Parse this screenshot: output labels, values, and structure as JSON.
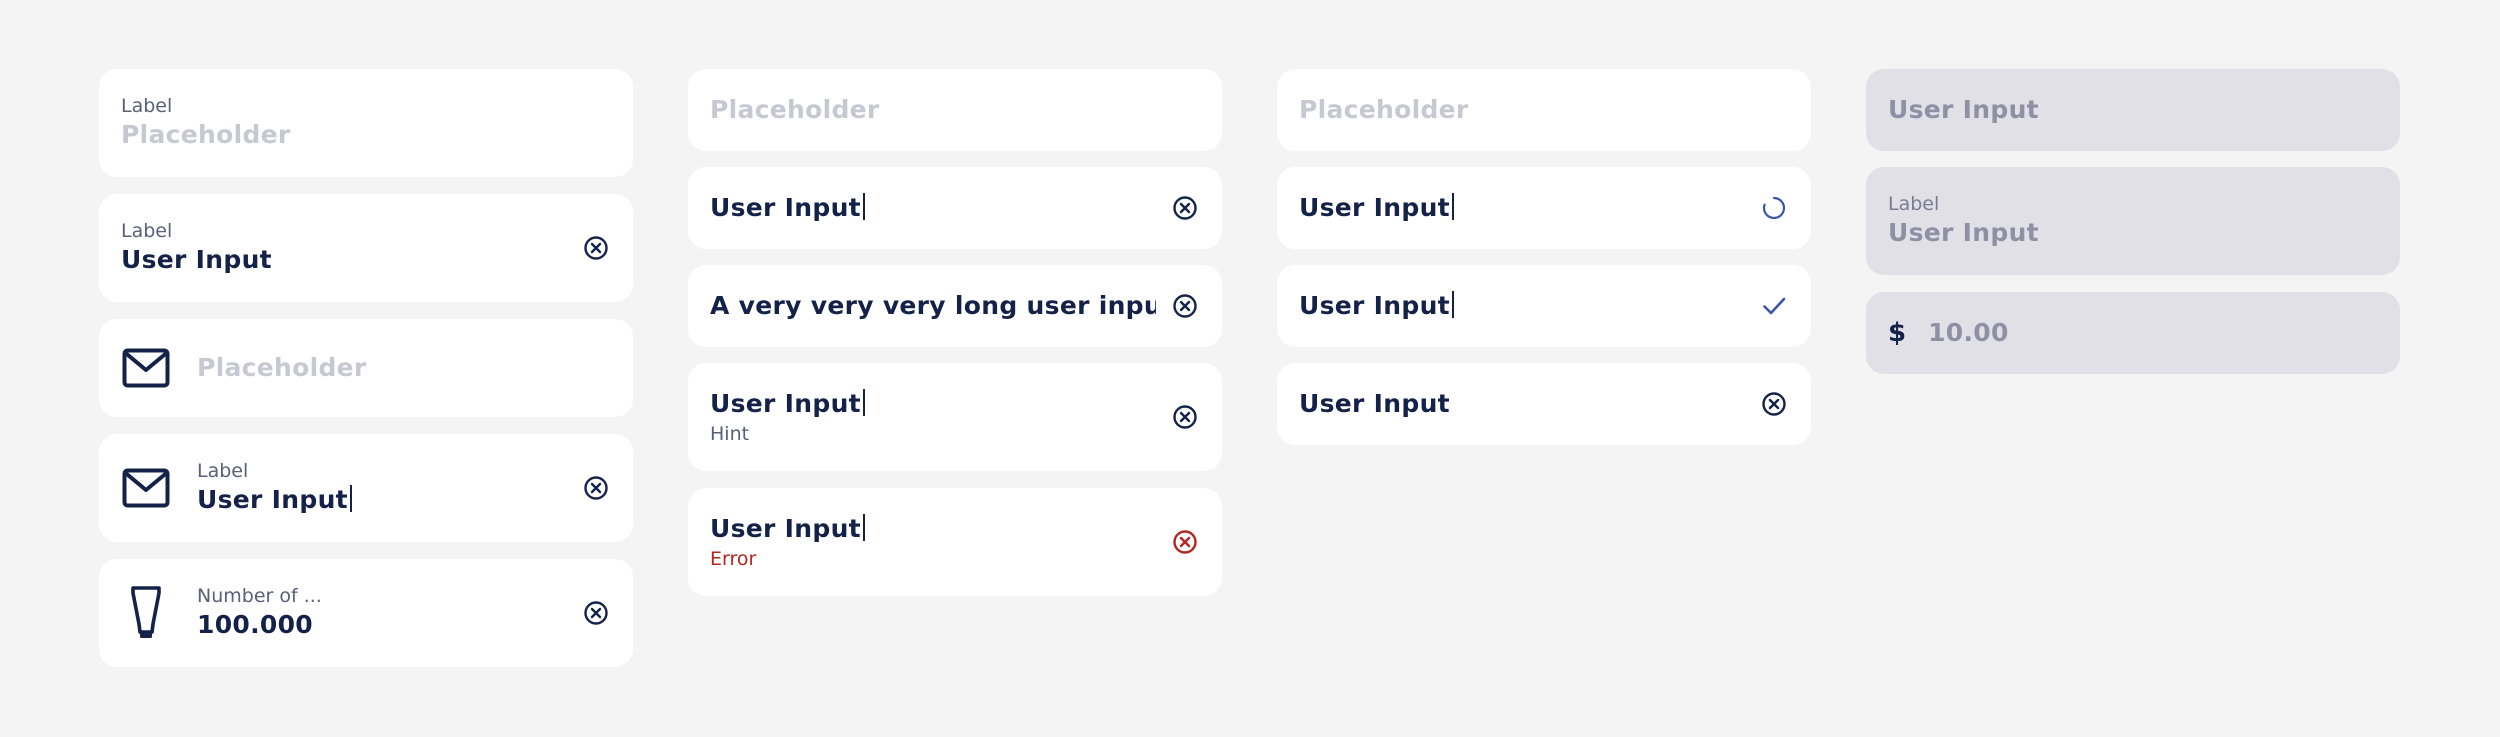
{
  "col1": {
    "f1": {
      "label": "Label",
      "placeholder": "Placeholder"
    },
    "f2": {
      "label": "Label",
      "value": "User Input"
    },
    "f3": {
      "placeholder": "Placeholder"
    },
    "f4": {
      "label": "Label",
      "value": "User Input"
    },
    "f5": {
      "label": "Number of ...",
      "value": "100.000"
    }
  },
  "col2": {
    "f1": {
      "placeholder": "Placeholder"
    },
    "f2": {
      "value": "User Input"
    },
    "f3": {
      "value": "A very very very long user input..."
    },
    "f4": {
      "value": "User Input",
      "hint": "Hint"
    },
    "f5": {
      "value": "User Input",
      "error": "Error"
    }
  },
  "col3": {
    "f1": {
      "placeholder": "Placeholder"
    },
    "f2": {
      "value": "User Input"
    },
    "f3": {
      "value": "User Input"
    },
    "f4": {
      "value": "User Input"
    }
  },
  "col4": {
    "f1": {
      "value": "User Input"
    },
    "f2": {
      "label": "Label",
      "value": "User Input"
    },
    "f3": {
      "currency": "$",
      "value": "10.00"
    }
  },
  "colors": {
    "background": "#f4f4f4",
    "field": "#ffffff",
    "disabled_field": "#e1e0e7",
    "text": "#14224a",
    "placeholder": "#c6c8d2",
    "error": "#b3261e",
    "check": "#3a55a8"
  },
  "icons": [
    "clear-icon",
    "mail-icon",
    "tube-icon",
    "loading-spinner-icon",
    "checkmark-icon",
    "error-clear-icon"
  ]
}
